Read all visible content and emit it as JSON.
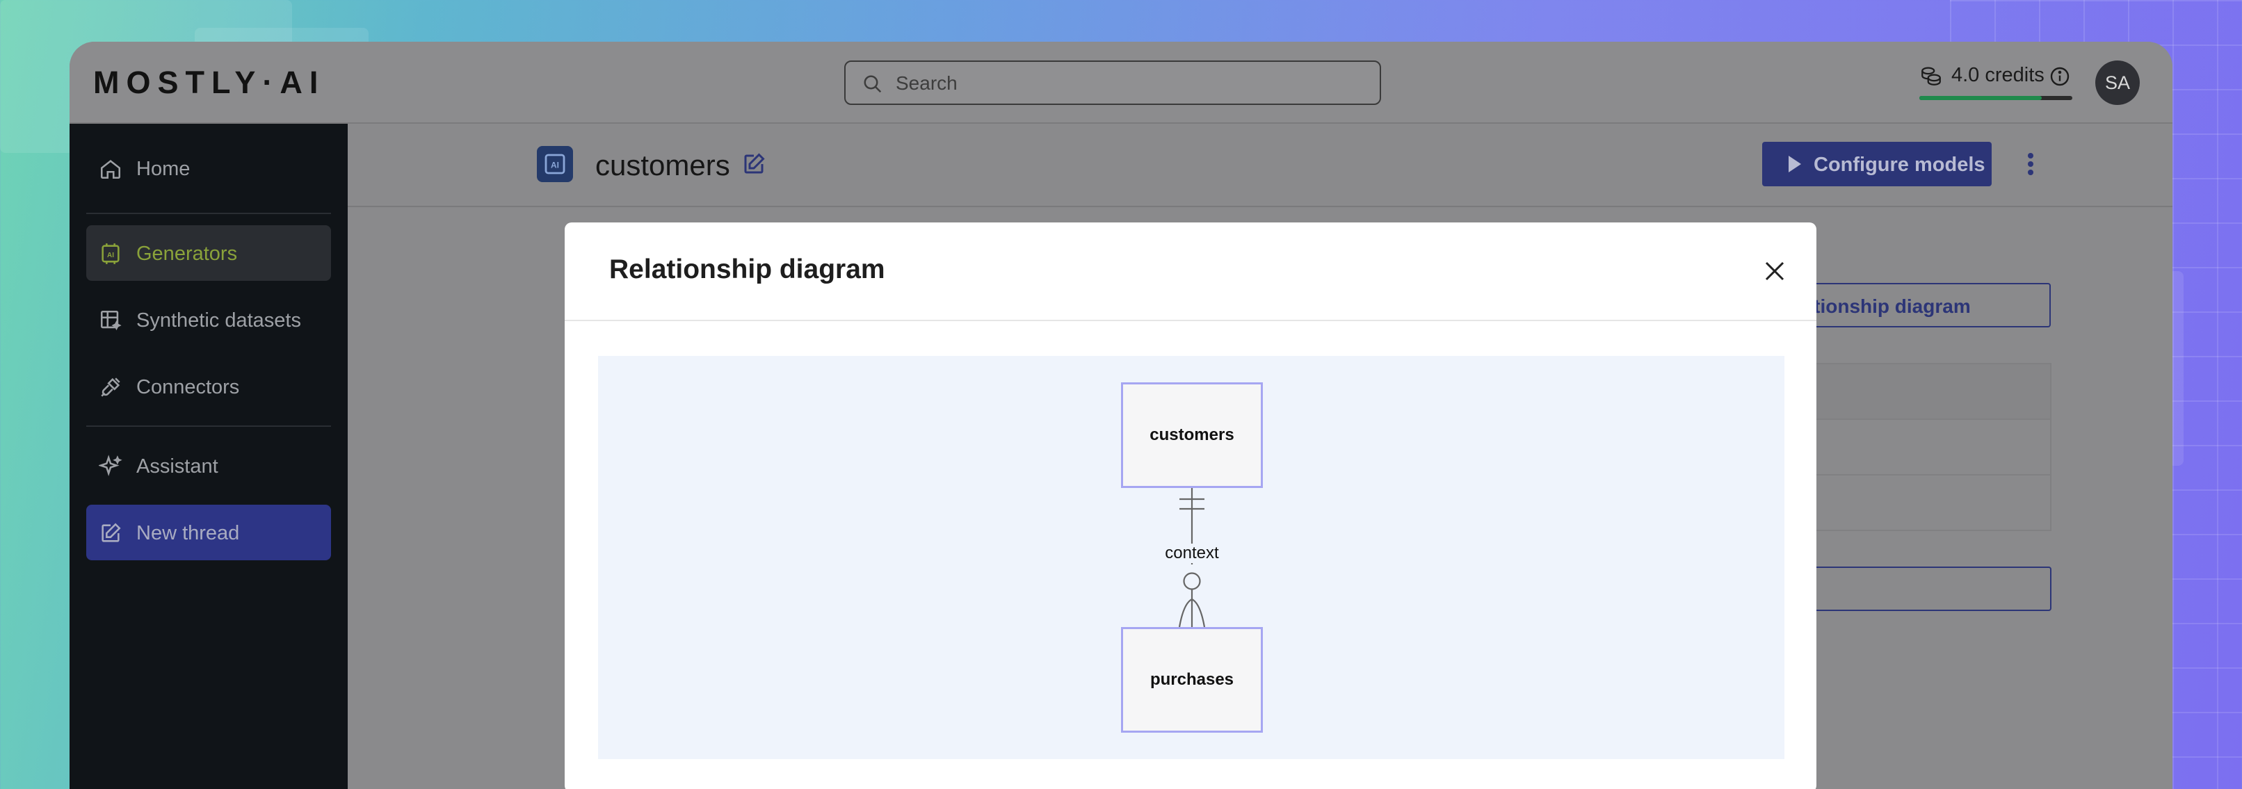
{
  "app": {
    "logo": "MOSTLY·AI",
    "search_placeholder": "Search",
    "credits_label": "4.0 credits",
    "credits_remaining_fraction": 0.8,
    "avatar_initials": "SA"
  },
  "sidebar": {
    "items": [
      {
        "label": "Home",
        "icon": "home-icon"
      },
      {
        "label": "Generators",
        "icon": "generator-icon",
        "active": true
      },
      {
        "label": "Synthetic datasets",
        "icon": "table-sparkle-icon"
      },
      {
        "label": "Connectors",
        "icon": "plug-icon"
      },
      {
        "label": "Assistant",
        "icon": "sparkle-icon"
      },
      {
        "label": "New thread",
        "icon": "edit-icon"
      }
    ]
  },
  "page": {
    "title": "customers",
    "configure_button": "Configure models",
    "relationship_button": "Relationship diagram"
  },
  "modal": {
    "title": "Relationship diagram",
    "close_icon": "close-icon"
  },
  "diagram": {
    "parent_table": "customers",
    "child_table": "purchases",
    "relation_label": "context",
    "relation_type": "one-to-zero-or-many"
  },
  "colors": {
    "accent": "#2c3577",
    "active_nav_text": "#8aa23a",
    "entity_border": "#a6a6f2",
    "diagram_bg": "#eff4fc",
    "credits_bar": "#1f8a4c"
  }
}
